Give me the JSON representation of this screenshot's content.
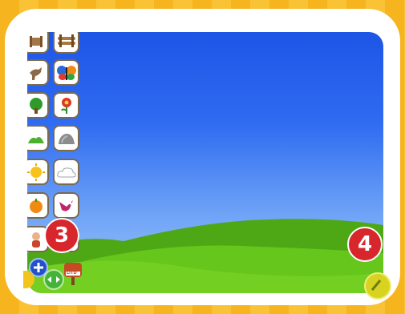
{
  "badges": {
    "left": "3",
    "right": "4"
  },
  "palette": {
    "left_items": [
      "fence-icon",
      "horse-icon",
      "tree-icon",
      "bush-icon",
      "sun-icon",
      "orange-icon",
      "person-icon"
    ],
    "right_items": [
      "log-fence-icon",
      "butterfly-icon",
      "flower-icon",
      "rock-icon",
      "cloud-icon",
      "bird-icon",
      "signpost-icon"
    ]
  },
  "controls": {
    "sign_text": "LITD"
  },
  "colors": {
    "badge": "#d7262c",
    "frame": "#ffffff",
    "sky_top": "#1d55e6",
    "grass": "#5dbf1c"
  }
}
